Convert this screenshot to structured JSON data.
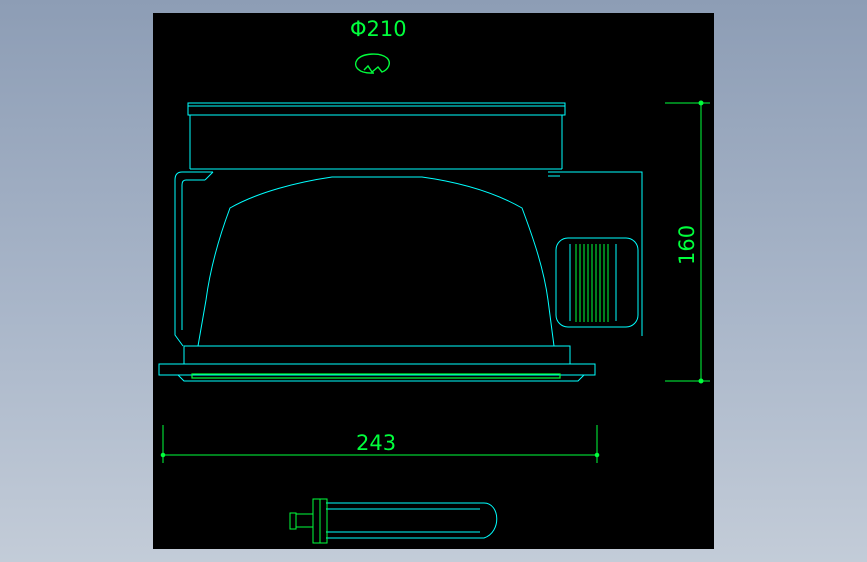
{
  "drawing": {
    "diameter_label": "Φ210",
    "width_label": "243",
    "height_label": "160"
  },
  "colors": {
    "background": "#000000",
    "outline": "#00ffff",
    "dimension": "#00ff3c",
    "frame": "#8d9db5"
  }
}
